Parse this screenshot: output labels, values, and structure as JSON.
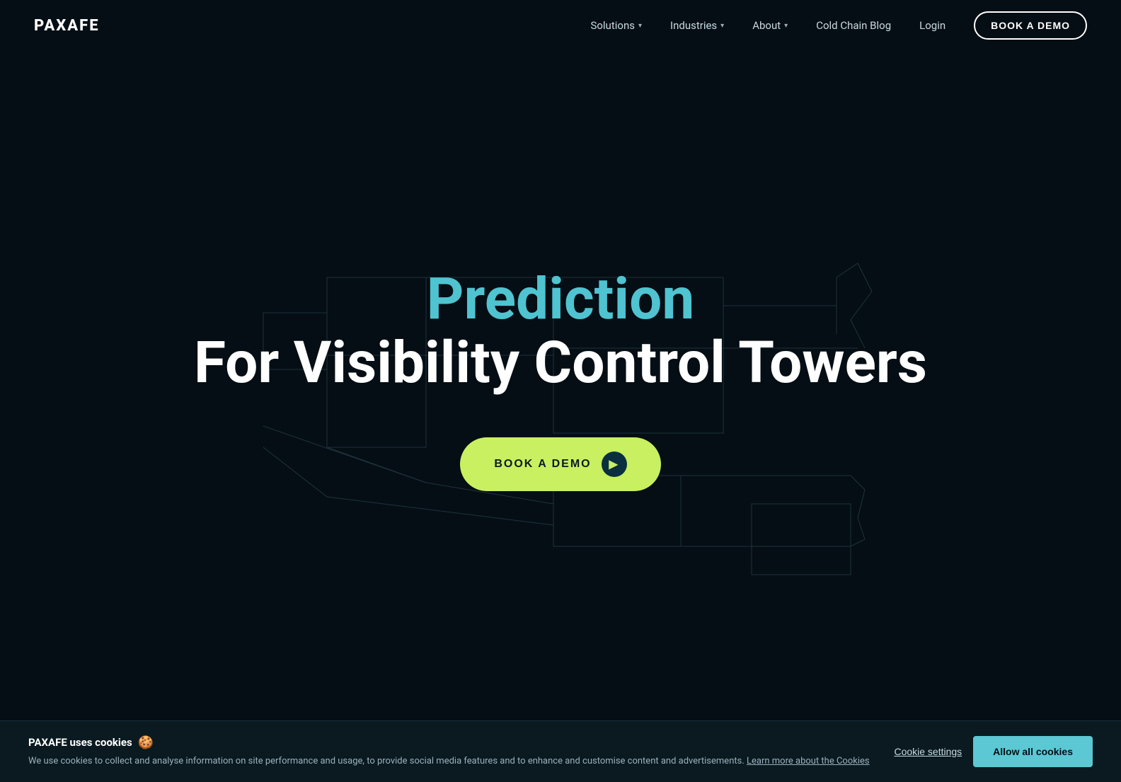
{
  "nav": {
    "logo": "PAXAFE",
    "links": [
      {
        "id": "solutions",
        "label": "Solutions",
        "has_dropdown": true
      },
      {
        "id": "industries",
        "label": "Industries",
        "has_dropdown": true
      },
      {
        "id": "about",
        "label": "About",
        "has_dropdown": true
      },
      {
        "id": "cold-chain-blog",
        "label": "Cold Chain Blog",
        "has_dropdown": false
      }
    ],
    "login_label": "Login",
    "cta_label": "BOOK A DEMO"
  },
  "hero": {
    "line1": "Prediction",
    "line2": "For Visibility Control Towers",
    "cta_label": "BOOK A DEMO"
  },
  "cookie": {
    "title": "PAXAFE uses cookies",
    "text": "We use cookies to collect and analyse information on site performance and usage, to provide social media features and to enhance and customise content and advertisements.",
    "learn_more_label": "Learn more about the Cookies",
    "settings_label": "Cookie settings",
    "allow_label": "Allow all cookies"
  }
}
